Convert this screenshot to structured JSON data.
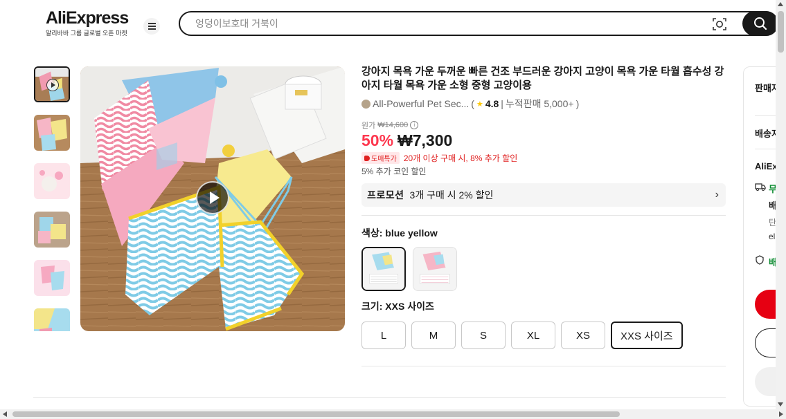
{
  "header": {
    "logo_text": "AliExpress",
    "logo_subtitle": "알리바바 그룹 글로벌 오픈 마켓",
    "search_placeholder": "엉덩이보호대 거북이"
  },
  "product": {
    "title": "강아지 목욕 가운 두꺼운 빠른 건조 부드러운 강아지 고양이 목욕 가운 타월 흡수성 강아지 타월 목욕 가운 소형 중형 고양이용",
    "store_name": "All-Powerful Pet Sec...",
    "rating": "4.8",
    "sold": "누적판매 5,000+",
    "original_label": "원가",
    "original_price": "₩14,600",
    "discount": "50%",
    "price": "₩7,300",
    "bulk_badge": "도매특가",
    "bulk_text": "20개 이상 구매 시, 8% 추가 할인",
    "coin_text": "5% 추가 코인 할인",
    "promo_label": "프로모션",
    "promo_text": "3개 구매 시 2% 할인",
    "color_label": "색상: blue yellow",
    "size_label": "크기: XXS 사이즈",
    "sizes": [
      "L",
      "M",
      "S",
      "XL",
      "XS",
      "XXS 사이즈"
    ],
    "selected_size": "XXS 사이즈",
    "colors": [
      "blue yellow",
      "pink blue"
    ],
    "selected_color": "blue yellow"
  },
  "side_panel": {
    "seller_label": "판매자",
    "shipping_label": "배송지",
    "aliexpress_label": "AliEx",
    "free_label": "무",
    "ship_label": "배",
    "sub1": "탄",
    "sub2": "el",
    "delivery_label": "배"
  },
  "colors": {
    "discount_red": "#fd384f",
    "bulk_red": "#e02020",
    "buy_red": "#e60012",
    "text_dark": "#191919",
    "green": "#0a8a2f"
  },
  "icons": [
    "menu-icon",
    "camera-search-icon",
    "search-icon",
    "play-icon",
    "star-icon",
    "info-icon",
    "tag-icon",
    "chevron-right-icon",
    "truck-icon",
    "shield-icon"
  ]
}
